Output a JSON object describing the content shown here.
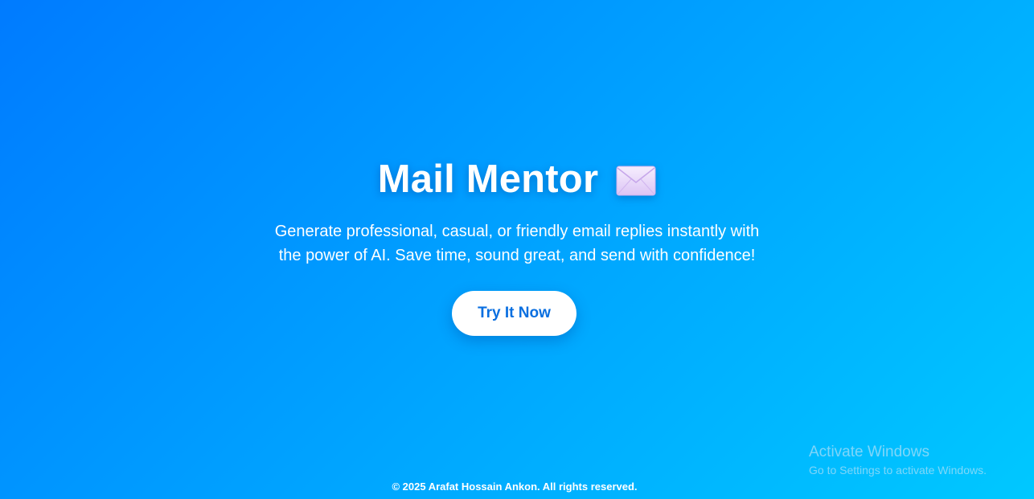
{
  "hero": {
    "title": "Mail Mentor",
    "title_icon": "envelope-icon",
    "tagline_line1": "Generate professional, casual, or friendly email replies instantly with",
    "tagline_line2": "the power of AI. Save time, sound great, and send with confidence!",
    "cta_label": "Try It Now"
  },
  "footer": {
    "text": "© 2025 Arafat Hossain Ankon. All rights reserved."
  },
  "os_watermark": {
    "title": "Activate Windows",
    "subtitle": "Go to Settings to activate Windows."
  },
  "colors": {
    "background_start": "#007bff",
    "background_end": "#00c8ff",
    "cta_background": "#ffffff",
    "cta_text": "#0a6fe0"
  }
}
